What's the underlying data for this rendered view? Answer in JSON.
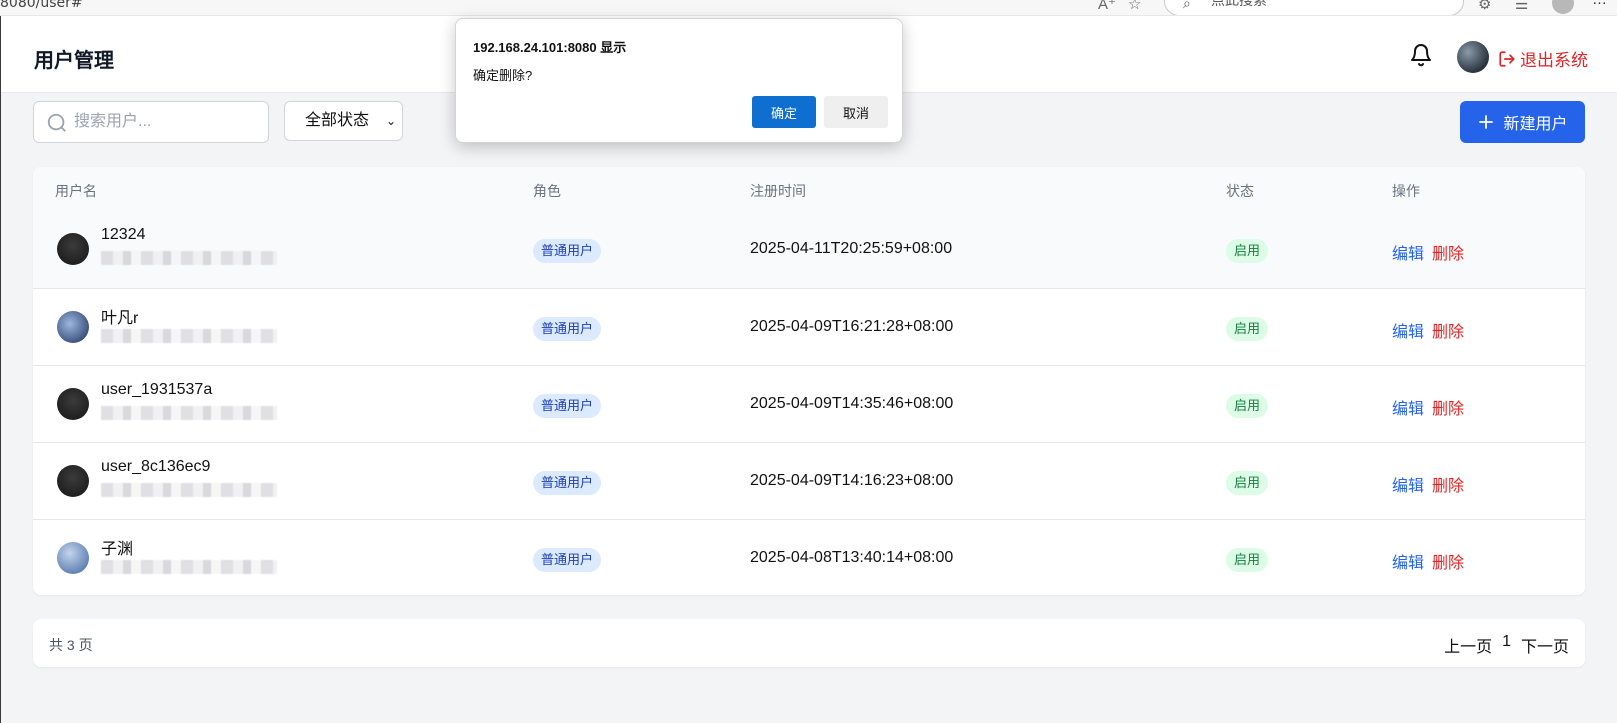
{
  "browser": {
    "url": "8080/user#",
    "search_placeholder": "点此搜索"
  },
  "header": {
    "title": "用户管理",
    "logout_label": "退出系统"
  },
  "toolbar": {
    "search_placeholder": "搜索用户...",
    "status_filter_value": "全部状态",
    "new_user_label": "新建用户"
  },
  "table": {
    "columns": [
      "用户名",
      "角色",
      "注册时间",
      "状态",
      "操作"
    ],
    "rows": [
      {
        "username": "12324",
        "role": "普通用户",
        "registered": "2025-04-11T20:25:59+08:00",
        "status": "启用",
        "edit": "编辑",
        "delete": "删除"
      },
      {
        "username": "叶凡r",
        "role": "普通用户",
        "registered": "2025-04-09T16:21:28+08:00",
        "status": "启用",
        "edit": "编辑",
        "delete": "删除"
      },
      {
        "username": "user_1931537a",
        "role": "普通用户",
        "registered": "2025-04-09T14:35:46+08:00",
        "status": "启用",
        "edit": "编辑",
        "delete": "删除"
      },
      {
        "username": "user_8c136ec9",
        "role": "普通用户",
        "registered": "2025-04-09T14:16:23+08:00",
        "status": "启用",
        "edit": "编辑",
        "delete": "删除"
      },
      {
        "username": "子渊",
        "role": "普通用户",
        "registered": "2025-04-08T13:40:14+08:00",
        "status": "启用",
        "edit": "编辑",
        "delete": "删除"
      }
    ]
  },
  "pagination": {
    "total": "共 3 页",
    "prev": "上一页",
    "current": "1",
    "next": "下一页"
  },
  "dialog": {
    "title": "192.168.24.101:8080 显示",
    "message": "确定删除?",
    "ok_label": "确定",
    "cancel_label": "取消"
  },
  "colors": {
    "primary": "#2563eb",
    "danger": "#dc2626",
    "role_badge_bg": "#dbeafe",
    "status_badge_bg": "#dcfce7",
    "dialog_ok": "#0f6fd0"
  }
}
